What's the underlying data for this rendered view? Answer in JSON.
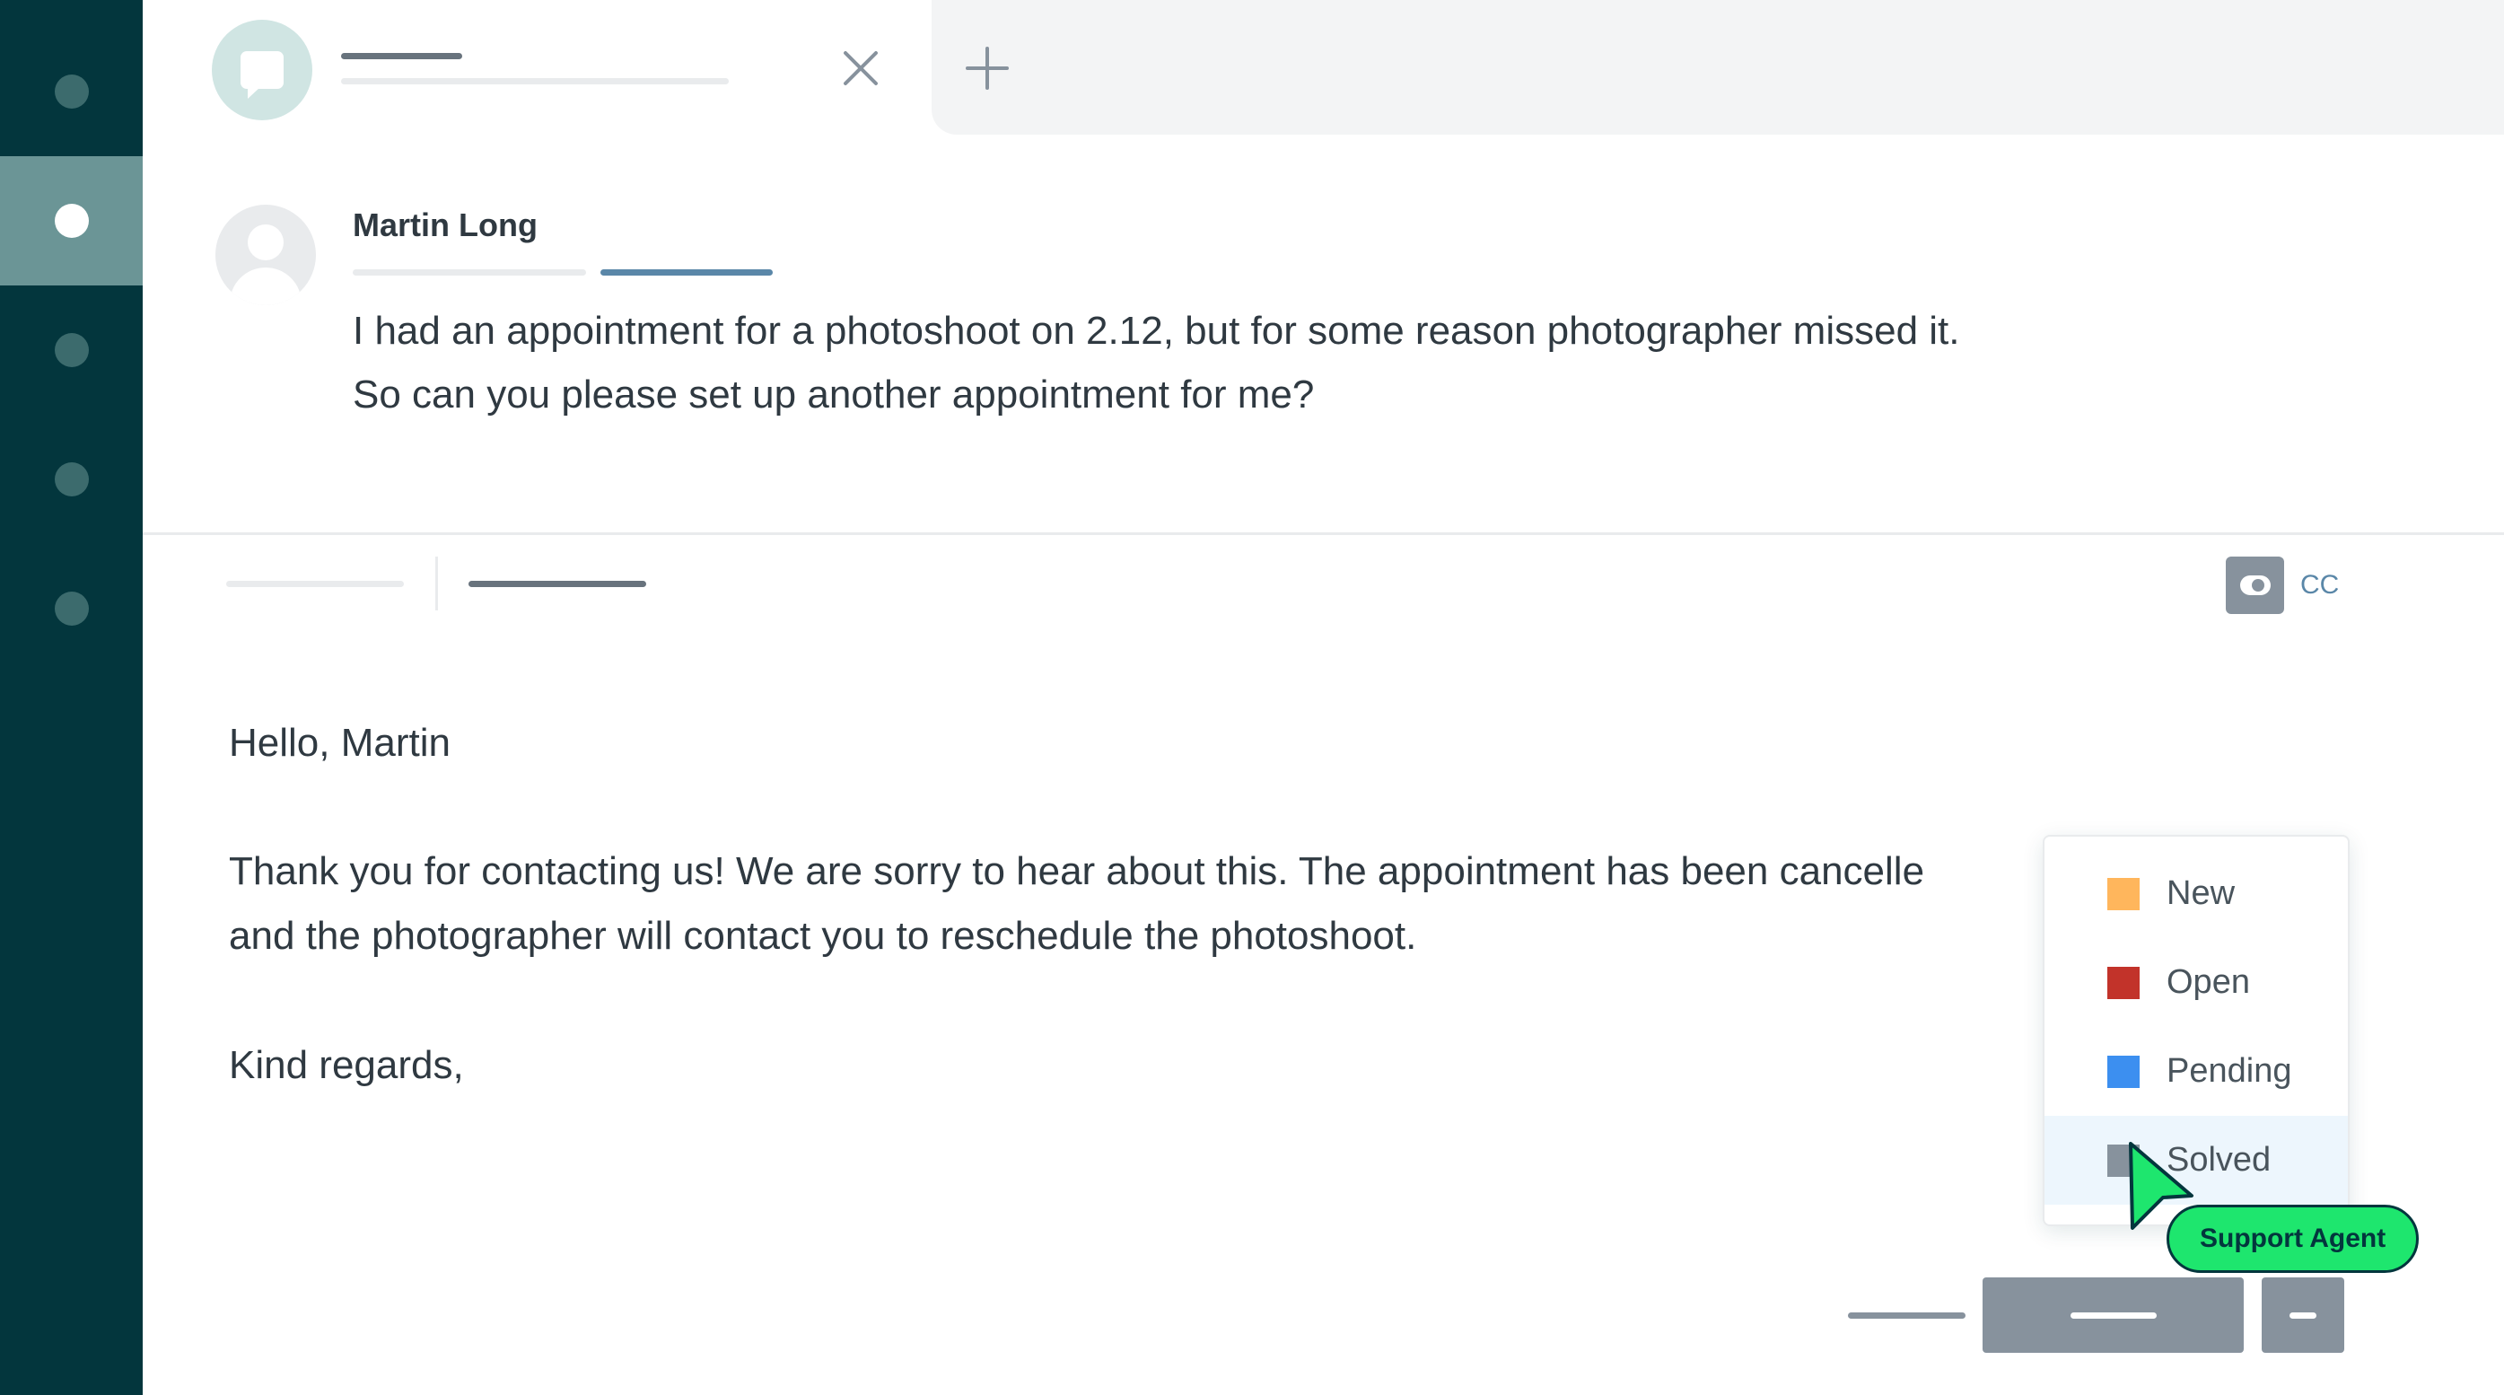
{
  "sidebar": {
    "items": [
      {
        "id": "nav-1",
        "active": false
      },
      {
        "id": "nav-2",
        "active": true
      },
      {
        "id": "nav-3",
        "active": false
      },
      {
        "id": "nav-4",
        "active": false
      },
      {
        "id": "nav-5",
        "active": false
      }
    ]
  },
  "tab": {
    "icon": "chat-bubble-icon",
    "close_icon": "close-icon",
    "add_icon": "plus-icon"
  },
  "message": {
    "author": "Martin Long",
    "lines": [
      "I had an appointment for a photoshoot on 2.12, but for some reason photographer missed it.",
      "So can you please set up another appointment for me?"
    ]
  },
  "reply": {
    "cc_label": "CC",
    "cc_icon": "toggle-icon",
    "lines": [
      "Hello, Martin",
      "Thank you for contacting us! We are sorry to hear about this. The appointment has been cancelle",
      "and the photographer will contact you to reschedule the photoshoot.",
      "Kind regards,"
    ]
  },
  "status_menu": {
    "options": [
      {
        "label": "New",
        "color": "#ffb65c"
      },
      {
        "label": "Open",
        "color": "#c2332a"
      },
      {
        "label": "Pending",
        "color": "#3c8ff0"
      },
      {
        "label": "Solved",
        "color": "#87929d"
      }
    ],
    "hovered": "Solved"
  },
  "cursor": {
    "label": "Support Agent",
    "color": "#1ee66e"
  },
  "colors": {
    "sidebar": "#03363d",
    "sidebar_active": "#6b9596",
    "accent": "#5a87a8"
  }
}
